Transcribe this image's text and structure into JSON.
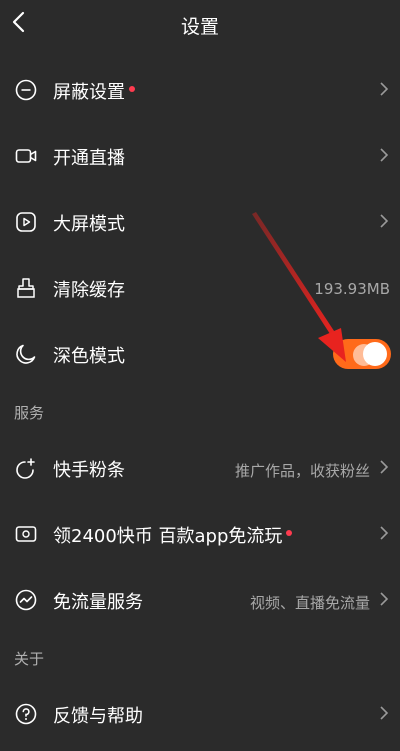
{
  "header": {
    "title": "设置",
    "back_icon": "back-icon"
  },
  "main_settings": [
    {
      "label": "屏蔽设置",
      "icon": "block-icon",
      "has_dot": true
    },
    {
      "label": "开通直播",
      "icon": "video-camera-icon"
    },
    {
      "label": "大屏模式",
      "icon": "big-screen-icon"
    },
    {
      "label": "清除缓存",
      "icon": "broom-icon",
      "value": "193.93MB"
    },
    {
      "label": "深色模式",
      "icon": "moon-icon",
      "toggle_on": true
    }
  ],
  "services": {
    "title": "服务",
    "items": [
      {
        "label": "快手粉条",
        "icon": "fan-strip-icon",
        "subtitle": "推广作品，收获粉丝"
      },
      {
        "label": "领2400快币 百款app免流玩",
        "icon": "coin-card-icon",
        "has_dot": true
      },
      {
        "label": "免流量服务",
        "icon": "data-free-icon",
        "subtitle": "视频、直播免流量"
      }
    ]
  },
  "about": {
    "title": "关于",
    "items": [
      {
        "label": "反馈与帮助",
        "icon": "help-icon"
      }
    ]
  },
  "colors": {
    "background": "#2b2b2b",
    "accent": "#ff6a1a",
    "dot": "#ff3b4f",
    "annotation": "#e8231f"
  }
}
